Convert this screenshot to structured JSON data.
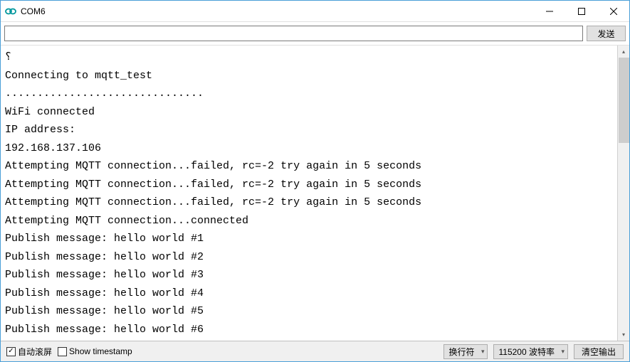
{
  "window": {
    "title": "COM6"
  },
  "toolbar": {
    "input_value": "",
    "send_label": "发送"
  },
  "console": {
    "lines": [
      "⸮",
      "Connecting to mqtt_test",
      "...............................",
      "WiFi connected",
      "IP address: ",
      "192.168.137.106",
      "Attempting MQTT connection...failed, rc=-2 try again in 5 seconds",
      "Attempting MQTT connection...failed, rc=-2 try again in 5 seconds",
      "Attempting MQTT connection...failed, rc=-2 try again in 5 seconds",
      "Attempting MQTT connection...connected",
      "Publish message: hello world #1",
      "Publish message: hello world #2",
      "Publish message: hello world #3",
      "Publish message: hello world #4",
      "Publish message: hello world #5",
      "Publish message: hello world #6"
    ]
  },
  "statusbar": {
    "autoscroll_label": "自动滚屏",
    "autoscroll_checked": true,
    "timestamp_label": "Show timestamp",
    "timestamp_checked": false,
    "line_ending_label": "换行符",
    "baud_label": "115200 波特率",
    "clear_label": "清空输出"
  }
}
